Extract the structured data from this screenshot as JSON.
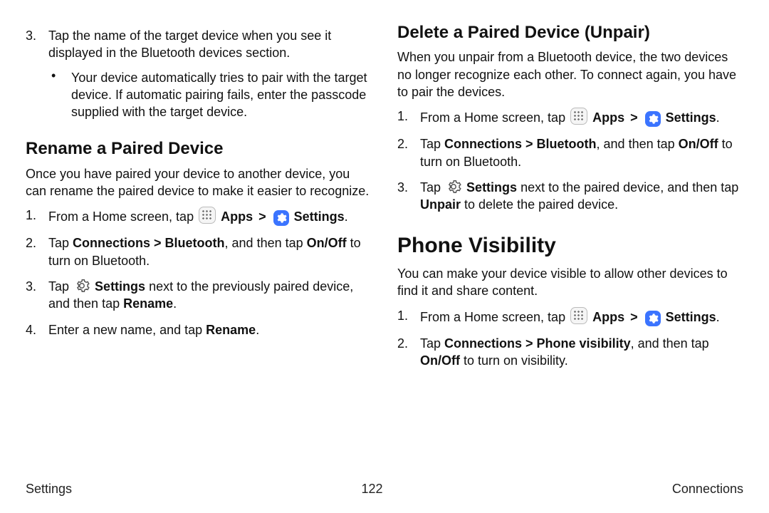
{
  "footer": {
    "left": "Settings",
    "page": "122",
    "right": "Connections"
  },
  "glyphs": {
    "chevron": ">",
    "bullet": "•"
  },
  "labels": {
    "apps": "Apps",
    "settings": "Settings"
  },
  "left": {
    "list3": {
      "num": "3.",
      "text": "Tap the name of the target device when you see it displayed in the Bluetooth devices section.",
      "bullet": "Your device automatically tries to pair with the target device. If automatic pairing fails, enter the passcode supplied with the target device."
    },
    "rename": {
      "heading": "Rename a Paired Device",
      "intro": "Once you have paired your device to another device, you can rename the paired device to make it easier to recognize.",
      "s1": {
        "num": "1.",
        "pre": "From a Home screen, tap ",
        "end": "."
      },
      "s2": {
        "num": "2.",
        "t1": "Tap ",
        "b1": "Connections > Bluetooth",
        "t2": ", and then tap ",
        "b2": "On/Off",
        "t3": " to turn on Bluetooth."
      },
      "s3": {
        "num": "3.",
        "t1": "Tap ",
        "b1": "Settings",
        "t2": " next to the previously paired device, and then tap ",
        "b2": "Rename",
        "t3": "."
      },
      "s4": {
        "num": "4.",
        "t1": "Enter a new name, and tap ",
        "b1": "Rename",
        "t2": "."
      }
    }
  },
  "right": {
    "delete": {
      "heading": "Delete a Paired Device (Unpair)",
      "intro": "When you unpair from a Bluetooth device, the two devices no longer recognize each other. To connect again, you have to pair the devices.",
      "s1": {
        "num": "1.",
        "pre": "From a Home screen, tap ",
        "end": "."
      },
      "s2": {
        "num": "2.",
        "t1": "Tap ",
        "b1": "Connections > Bluetooth",
        "t2": ", and then tap ",
        "b2": "On/Off",
        "t3": " to turn on Bluetooth."
      },
      "s3": {
        "num": "3.",
        "t1": "Tap ",
        "b1": "Settings",
        "t2": " next to the paired device, and then tap ",
        "b2": "Unpair",
        "t3": " to delete the paired device."
      }
    },
    "visibility": {
      "heading": "Phone Visibility",
      "intro": "You can make your device visible to allow other devices to find it and share content.",
      "s1": {
        "num": "1.",
        "pre": "From a Home screen, tap ",
        "end": "."
      },
      "s2": {
        "num": "2.",
        "t1": "Tap ",
        "b1": "Connections > Phone visibility",
        "t2": ", and then tap ",
        "b2": "On/Off",
        "t3": " to turn on visibility."
      }
    }
  }
}
